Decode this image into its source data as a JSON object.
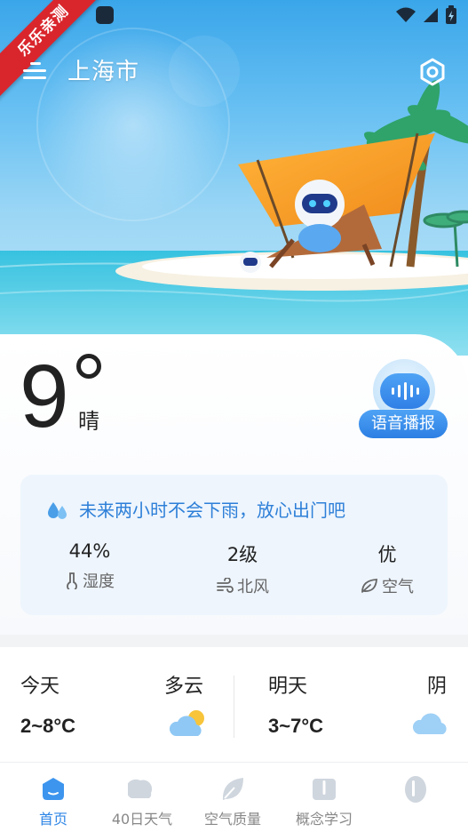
{
  "status_bar": {
    "ribbon_text": "乐乐亲测",
    "ribbon_color": "#d9262d",
    "icons": [
      "wifi-icon",
      "signal-icon",
      "battery-icon"
    ]
  },
  "header": {
    "city": "上海市",
    "menu_icon": "menu-icon",
    "settings_icon": "settings-icon"
  },
  "current": {
    "temperature": "9",
    "condition": "晴",
    "voice_button_label": "语音播报"
  },
  "rain_tip": {
    "icon": "raindrops-icon",
    "text": "未来两小时不会下雨，放心出门吧"
  },
  "stats": [
    {
      "value": "44%",
      "label": "湿度",
      "icon": "thermometer-icon"
    },
    {
      "value": "2级",
      "label": "北风",
      "icon": "wind-icon"
    },
    {
      "value": "优",
      "label": "空气",
      "icon": "leaf-icon"
    }
  ],
  "forecast": {
    "today": {
      "day": "今天",
      "condition": "多云",
      "range": "2~8°C",
      "icon": "partly-cloudy-icon"
    },
    "tomorrow": {
      "day": "明天",
      "condition": "阴",
      "range": "3~7°C",
      "icon": "cloudy-icon"
    }
  },
  "bottom_nav": [
    {
      "label": "首页",
      "icon": "home-icon",
      "active": true
    },
    {
      "label": "40日天气",
      "icon": "forecast-40-icon",
      "active": false
    },
    {
      "label": "空气质量",
      "icon": "leaf-nav-icon",
      "active": false
    },
    {
      "label": "概念学习",
      "icon": "book-icon",
      "active": false
    },
    {
      "label": "",
      "icon": "extra-nav-icon",
      "active": false
    }
  ],
  "colors": {
    "accent": "#2f86e6",
    "tip_text": "#2d7fd8",
    "info_card_bg": "#eef5fd"
  }
}
